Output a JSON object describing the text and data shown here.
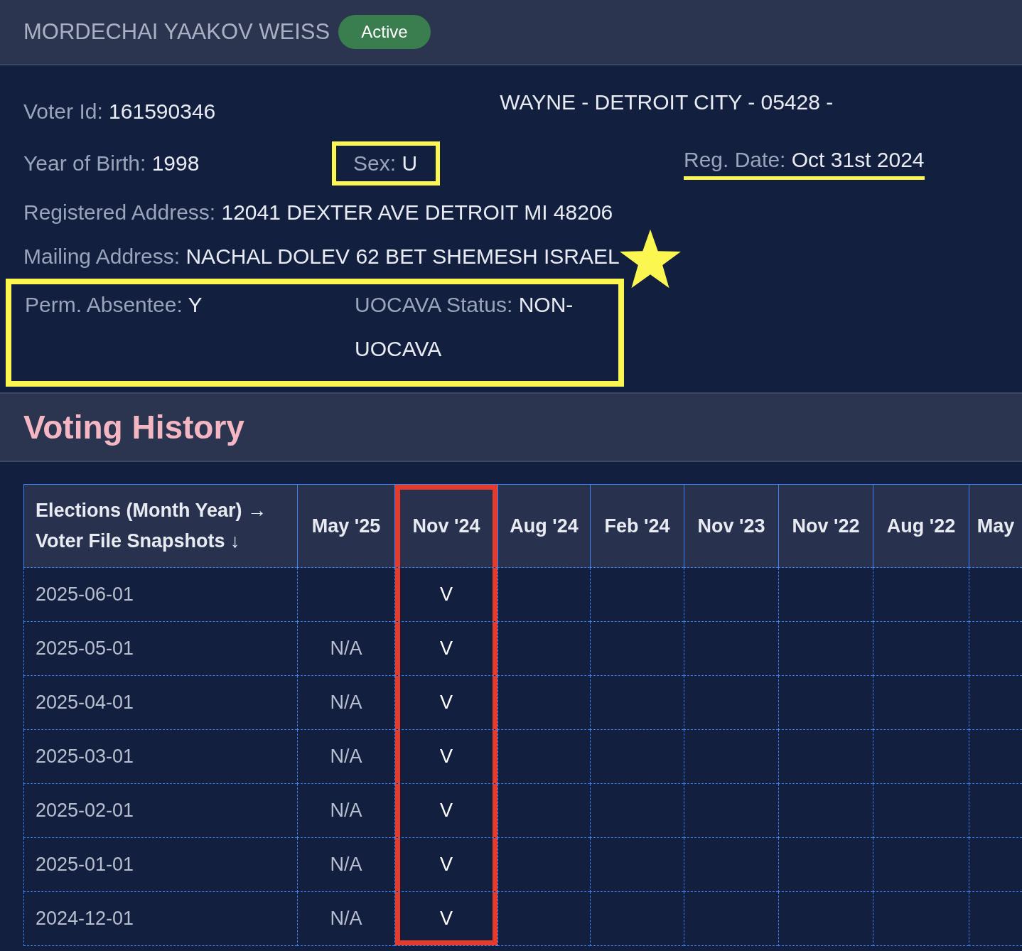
{
  "header": {
    "name": "MORDECHAI YAAKOV WEISS",
    "status": "Active"
  },
  "info": {
    "voter_id": {
      "label": "Voter Id:",
      "value": "161590346"
    },
    "location": "WAYNE - DETROIT CITY - 05428 -",
    "year_of_birth": {
      "label": "Year of Birth:",
      "value": "1998"
    },
    "sex": {
      "label": "Sex:",
      "value": "U",
      "boxed": true
    },
    "reg_date": {
      "label": "Reg. Date:",
      "value": "Oct 31st 2024",
      "underlined": true
    },
    "registered_address": {
      "label": "Registered Address:",
      "value": "12041 DEXTER AVE DETROIT MI 48206"
    },
    "mailing_address": {
      "label": "Mailing Address:",
      "value": "NACHAL DOLEV 62 BET SHEMESH ISRAEL",
      "starred": true
    },
    "absentee": {
      "boxed": true,
      "fields": [
        {
          "label": "Perm. Absentee:",
          "value": "Y"
        },
        {
          "label": "UOCAVA Status:",
          "value": "NON-UOCAVA"
        }
      ]
    }
  },
  "history": {
    "title": "Voting History",
    "corner": [
      "Elections (Month Year) →",
      "Voter File Snapshots ↓"
    ],
    "columns": [
      {
        "label": "May '25",
        "highlighted": false
      },
      {
        "label": "Nov '24",
        "highlighted": true
      },
      {
        "label": "Aug '24",
        "highlighted": false
      },
      {
        "label": "Feb '24",
        "highlighted": false
      },
      {
        "label": "Nov '23",
        "highlighted": false
      },
      {
        "label": "Nov '22",
        "highlighted": false
      },
      {
        "label": "Aug '22",
        "highlighted": false
      },
      {
        "label": "May",
        "highlighted": false
      }
    ],
    "rows": [
      {
        "date": "2025-06-01",
        "cells": [
          null,
          "V",
          null,
          null,
          null,
          null,
          null,
          null
        ]
      },
      {
        "date": "2025-05-01",
        "cells": [
          "N/A",
          "V",
          null,
          null,
          null,
          null,
          null,
          null
        ]
      },
      {
        "date": "2025-04-01",
        "cells": [
          "N/A",
          "V",
          null,
          null,
          null,
          null,
          null,
          null
        ]
      },
      {
        "date": "2025-03-01",
        "cells": [
          "N/A",
          "V",
          null,
          null,
          null,
          null,
          null,
          null
        ]
      },
      {
        "date": "2025-02-01",
        "cells": [
          "N/A",
          "V",
          null,
          null,
          null,
          null,
          null,
          null
        ]
      },
      {
        "date": "2025-01-01",
        "cells": [
          "N/A",
          "V",
          null,
          null,
          null,
          null,
          null,
          null
        ]
      },
      {
        "date": "2024-12-01",
        "cells": [
          "N/A",
          "V",
          null,
          null,
          null,
          null,
          null,
          null
        ]
      }
    ]
  }
}
